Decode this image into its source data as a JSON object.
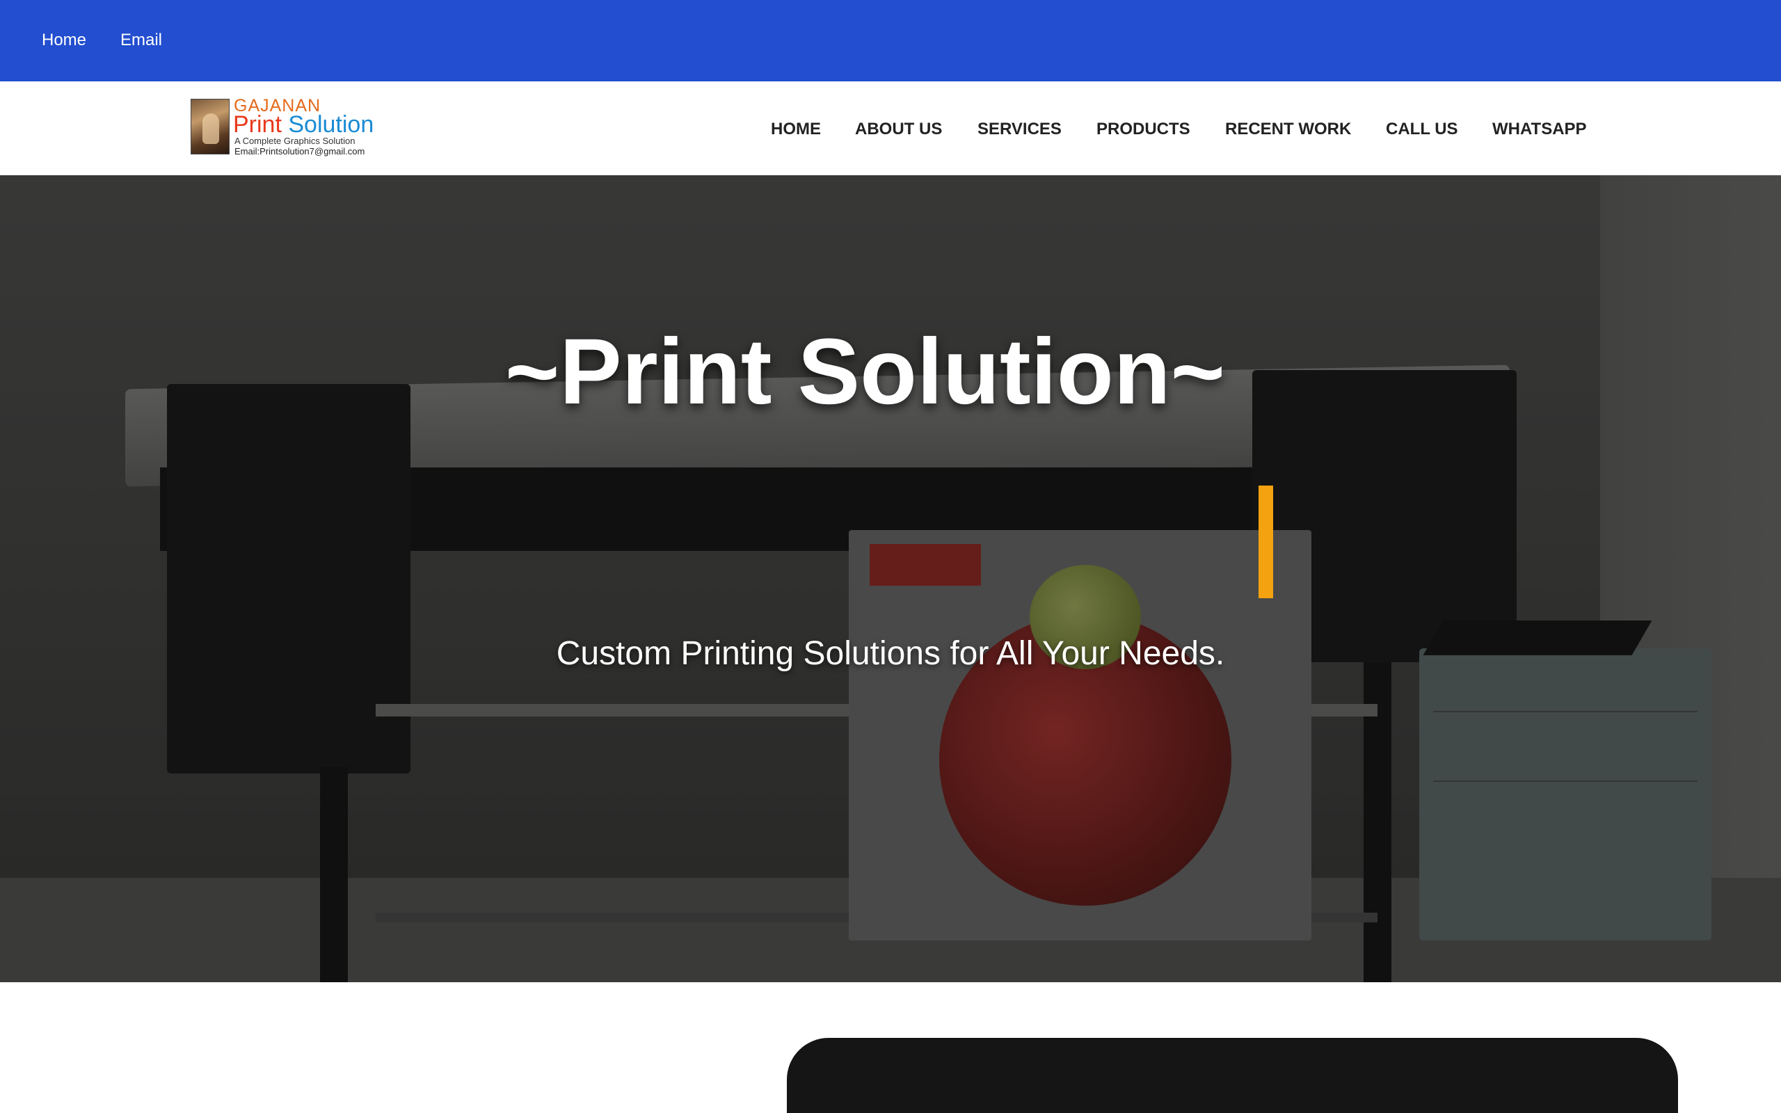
{
  "topbar": {
    "links": [
      "Home",
      "Email"
    ],
    "color": "#224ecf"
  },
  "logo": {
    "title_line1": "GAJANAN",
    "title_part1": "Print",
    "title_part2": "Solution",
    "tagline": "A Complete Graphics Solution",
    "email": "Email:Printsolution7@gmail.com"
  },
  "nav": {
    "items": [
      "HOME",
      "ABOUT US",
      "SERVICES",
      "PRODUCTS",
      "RECENT WORK",
      "CALL US",
      "WHATSAPP"
    ]
  },
  "hero": {
    "title": "~Print Solution~",
    "subtitle": "Custom Printing Solutions for All Your Needs.",
    "cursor_color": "#f4a20f"
  }
}
